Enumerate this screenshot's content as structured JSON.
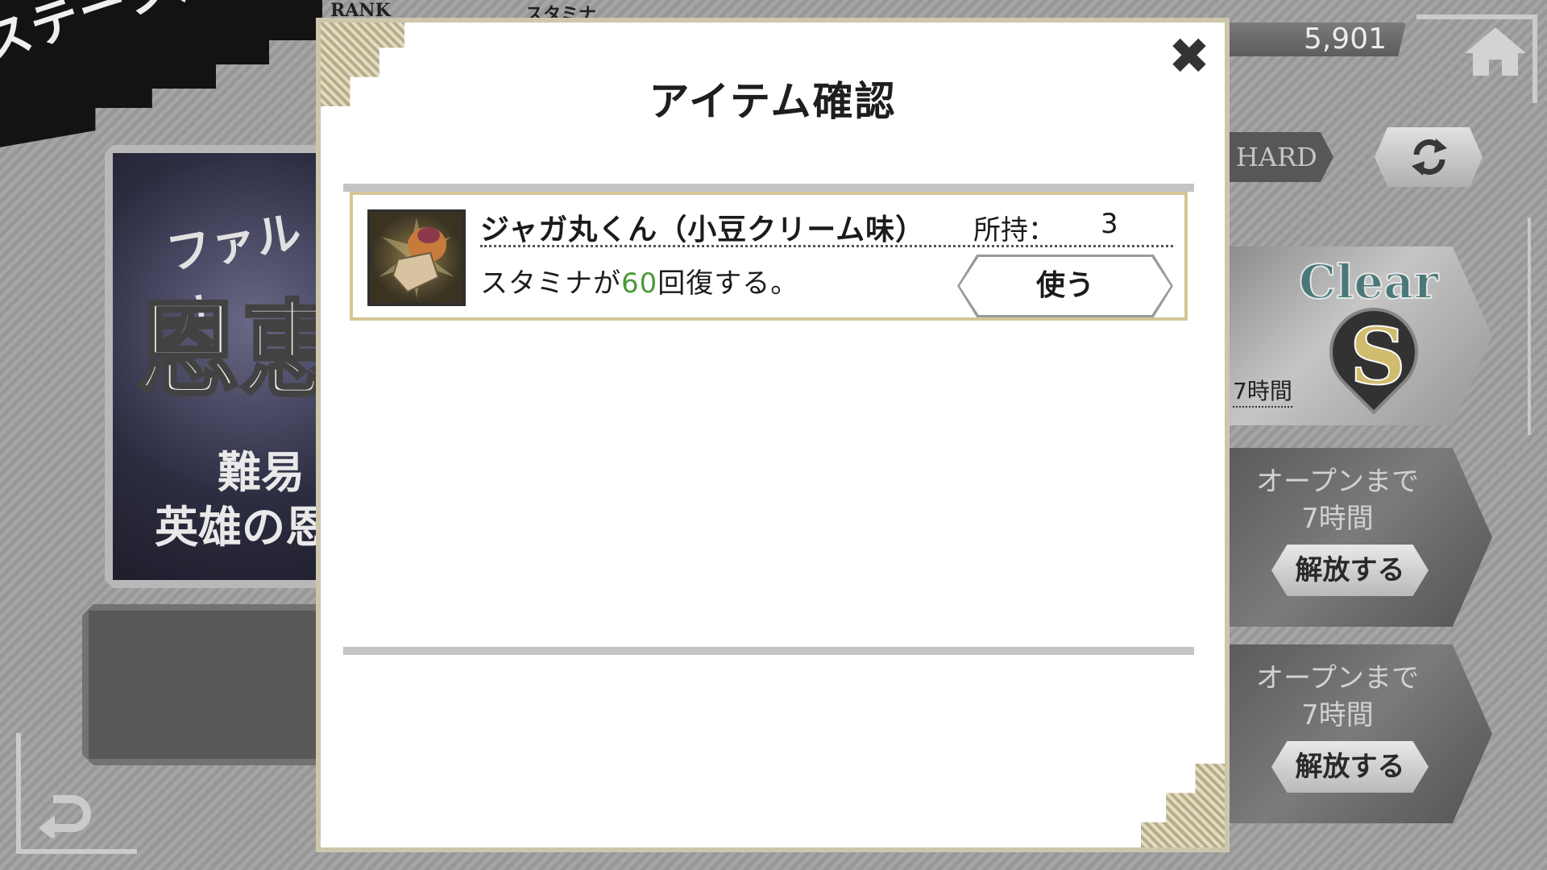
{
  "background": {
    "screen_title": "ステージ選択",
    "header_labels": {
      "rank": "RANK",
      "stamina": "スタミナ"
    },
    "currency_value": "5,901",
    "difficulty_tab": "HARD",
    "banner": {
      "line1": "ファルナ",
      "line2": "恩恵",
      "line3": "難易",
      "line4": "英雄の恩"
    },
    "stage_cards": [
      {
        "status": "clear",
        "clear_label": "Clear",
        "rank": "S",
        "time_text": "7時間"
      },
      {
        "status": "locked",
        "open_text": "オープンまで",
        "time_text": "7時間",
        "release_label": "解放する"
      },
      {
        "status": "locked",
        "open_text": "オープンまで",
        "time_text": "7時間",
        "release_label": "解放する"
      }
    ]
  },
  "modal": {
    "title": "アイテム確認",
    "close_icon": "close-icon",
    "items": [
      {
        "name": "ジャガ丸くん（小豆クリーム味）",
        "owned_label": "所持：",
        "owned_count": "3",
        "description_prefix": "スタミナが",
        "description_amount": "60",
        "description_suffix": "回復する。",
        "use_label": "使う",
        "icon": "jagamaru-kun-icon"
      }
    ]
  },
  "colors": {
    "accent_green": "#4a9a3a",
    "frame_gold": "#d2c896",
    "modal_border": "#cdc6ad"
  }
}
